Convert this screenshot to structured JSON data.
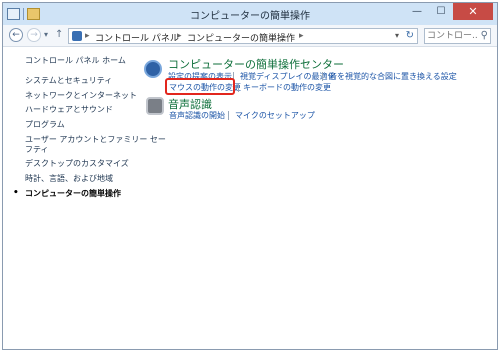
{
  "window": {
    "title": "コンピューターの簡単操作",
    "controls": {
      "minimize": "—",
      "maximize": "☐",
      "close": "✕"
    }
  },
  "toolbar": {
    "back_glyph": "←",
    "forward_glyph": "→",
    "up_glyph": "↑",
    "dropdown_glyph": "▾"
  },
  "address": {
    "crumbs": [
      "コントロール パネル",
      "コンピューターの簡単操作"
    ],
    "separator": "▸",
    "refresh_glyph": "↻"
  },
  "search": {
    "placeholder": "コントロー..."
  },
  "sidebar": {
    "items": [
      {
        "label": "コントロール パネル ホーム"
      },
      {
        "label": "システムとセキュリティ"
      },
      {
        "label": "ネットワークとインターネット"
      },
      {
        "label": "ハードウェアとサウンド"
      },
      {
        "label": "プログラム"
      },
      {
        "label": "ユーザー アカウントとファミリー セー"
      },
      {
        "label": "フティ"
      },
      {
        "label": "デスクトップのカスタマイズ"
      },
      {
        "label": "時計、言語、および地域"
      },
      {
        "label": "コンピューターの簡単操作",
        "current": true
      }
    ]
  },
  "main": {
    "categories": [
      {
        "title": "コンピューターの簡単操作センター",
        "icon": "ease-of-access-icon",
        "links_row1": [
          "設定の提案の表示",
          "視覚ディスプレイの最適化",
          "音を視覚的な合図に置き換える設定"
        ],
        "links_row2": [
          "マウスの動作の変更",
          "キーボードの動作の変更"
        ]
      },
      {
        "title": "音声認識",
        "icon": "microphone-icon",
        "links_row1": [
          "音声認識の開始",
          "マイクのセットアップ"
        ]
      }
    ]
  },
  "colors": {
    "titlebar": "#cfe3f6",
    "category_title": "#0c6e39",
    "link": "#1a53a6",
    "highlight": "#e2261d",
    "close_button": "#c74b45"
  }
}
